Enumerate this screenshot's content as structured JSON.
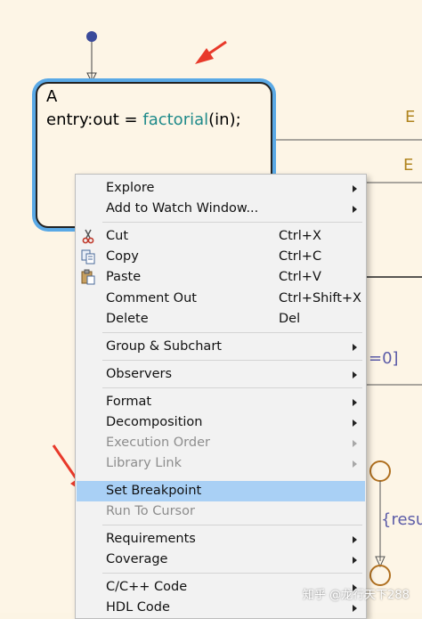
{
  "chart": {
    "state": {
      "name": "A",
      "action_prefix": "entry:out = ",
      "action_function": "factorial",
      "action_suffix": "(in);"
    },
    "transition_labels": [
      "E",
      "E"
    ],
    "condition_fragment": "=0]",
    "result_fragment": "{resu"
  },
  "context_menu": {
    "groups": [
      [
        {
          "label": "Explore",
          "submenu": true
        },
        {
          "label": "Add to Watch Window...",
          "submenu": true
        }
      ],
      [
        {
          "label": "Cut",
          "shortcut": "Ctrl+X",
          "icon": "scissors-icon"
        },
        {
          "label": "Copy",
          "shortcut": "Ctrl+C",
          "icon": "copy-icon"
        },
        {
          "label": "Paste",
          "shortcut": "Ctrl+V",
          "icon": "paste-icon"
        },
        {
          "label": "Comment Out",
          "shortcut": "Ctrl+Shift+X"
        },
        {
          "label": "Delete",
          "shortcut": "Del"
        }
      ],
      [
        {
          "label": "Group & Subchart",
          "submenu": true
        }
      ],
      [
        {
          "label": "Observers",
          "submenu": true
        }
      ],
      [
        {
          "label": "Format",
          "submenu": true
        },
        {
          "label": "Decomposition",
          "submenu": true
        },
        {
          "label": "Execution Order",
          "submenu": true,
          "disabled": true
        },
        {
          "label": "Library Link",
          "submenu": true,
          "disabled": true
        },
        {
          "label": "Set Breakpoint",
          "highlighted": true
        },
        {
          "label": "Run To Cursor",
          "disabled": true
        }
      ],
      [
        {
          "label": "Requirements",
          "submenu": true
        },
        {
          "label": "Coverage",
          "submenu": true
        }
      ],
      [
        {
          "label": "C/C++ Code",
          "submenu": true
        },
        {
          "label": "HDL Code",
          "submenu": true
        }
      ]
    ]
  },
  "annotations": {
    "arrow_color": "#e8392a"
  },
  "colors": {
    "canvas": "#fdf5e6",
    "state_highlight": "#5aa9e6",
    "menu_highlight": "#a9d0f5",
    "function": "#1f8a8a"
  },
  "watermark": "知乎 @龙行天下288"
}
